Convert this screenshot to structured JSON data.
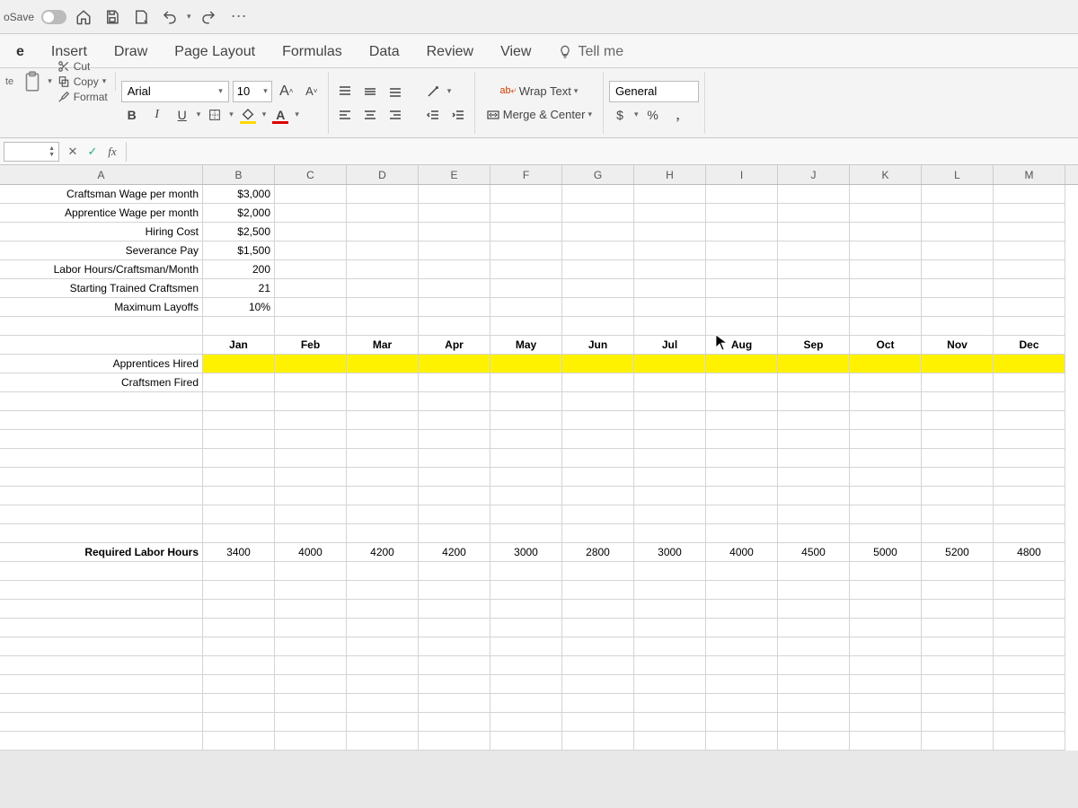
{
  "titlebar": {
    "autosave": "oSave"
  },
  "ribbon_tabs": {
    "edge": "e",
    "items": [
      "Insert",
      "Draw",
      "Page Layout",
      "Formulas",
      "Data",
      "Review",
      "View"
    ],
    "tellme": "Tell me"
  },
  "clipboard": {
    "side_label": "te",
    "cut": "Cut",
    "copy": "Copy",
    "format": "Format"
  },
  "font": {
    "name": "Arial",
    "size": "10",
    "bigA": "Aˆ",
    "smallA": "Aˇ"
  },
  "alignment": {
    "wrap": "Wrap Text",
    "merge": "Merge & Center"
  },
  "number": {
    "format": "General",
    "currency": "$",
    "percent": "%",
    "comma": ","
  },
  "colheads": [
    "A",
    "B",
    "C",
    "D",
    "E",
    "F",
    "G",
    "H",
    "I",
    "J",
    "K",
    "L",
    "M"
  ],
  "params": [
    {
      "label": "Craftsman Wage per month",
      "value": "$3,000"
    },
    {
      "label": "Apprentice Wage per month",
      "value": "$2,000"
    },
    {
      "label": "Hiring Cost",
      "value": "$2,500"
    },
    {
      "label": "Severance Pay",
      "value": "$1,500"
    },
    {
      "label": "Labor Hours/Craftsman/Month",
      "value": "200"
    },
    {
      "label": "Starting Trained Craftsmen",
      "value": "21"
    },
    {
      "label": "Maximum Layoffs",
      "value": "10%"
    }
  ],
  "months": [
    "Jan",
    "Feb",
    "Mar",
    "Apr",
    "May",
    "Jun",
    "Jul",
    "Aug",
    "Sep",
    "Oct",
    "Nov",
    "Dec"
  ],
  "decision_rows": [
    "Apprentices Hired",
    "Craftsmen Fired"
  ],
  "required_label": "Required Labor Hours",
  "required": [
    "3400",
    "4000",
    "4200",
    "4200",
    "3000",
    "2800",
    "3000",
    "4000",
    "4500",
    "5000",
    "5200",
    "4800"
  ],
  "chart_data": {
    "type": "table",
    "title": "Workforce Planning Parameters",
    "parameters": {
      "Craftsman Wage per month": 3000,
      "Apprentice Wage per month": 2000,
      "Hiring Cost": 2500,
      "Severance Pay": 1500,
      "Labor Hours/Craftsman/Month": 200,
      "Starting Trained Craftsmen": 21,
      "Maximum Layoffs": 0.1
    },
    "series": [
      {
        "name": "Required Labor Hours",
        "categories": [
          "Jan",
          "Feb",
          "Mar",
          "Apr",
          "May",
          "Jun",
          "Jul",
          "Aug",
          "Sep",
          "Oct",
          "Nov",
          "Dec"
        ],
        "values": [
          3400,
          4000,
          4200,
          4200,
          3000,
          2800,
          3000,
          4000,
          4500,
          5000,
          5200,
          4800
        ]
      }
    ]
  }
}
